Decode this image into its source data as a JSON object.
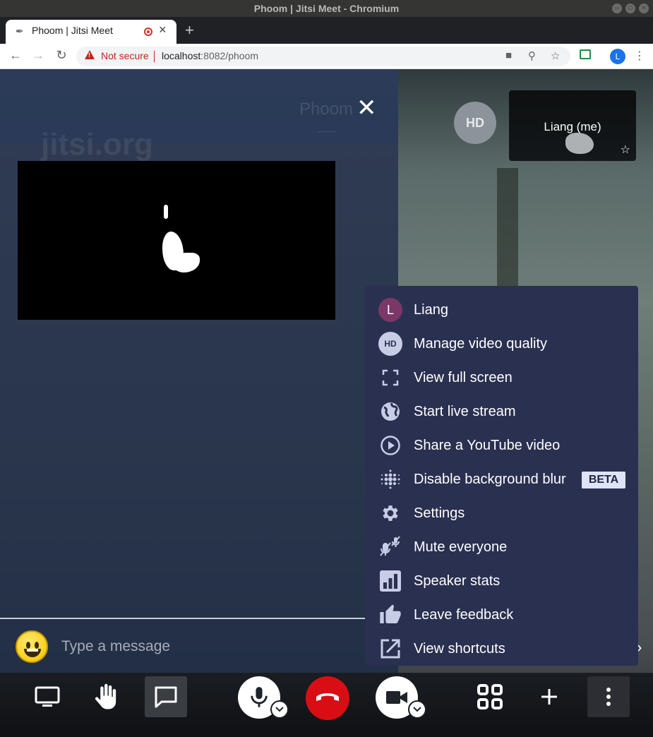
{
  "window": {
    "title": "Phoom | Jitsi Meet - Chromium"
  },
  "browser": {
    "tab_title": "Phoom | Jitsi Meet",
    "security_label": "Not secure",
    "url_host": "localhost",
    "url_path": ":8082/phoom",
    "profile_initial": "L"
  },
  "meeting": {
    "watermark": "jitsi.org",
    "subject": "Phoom",
    "subject_sub": "——",
    "participant_avatar": "HD",
    "self_name": "Liang (me)"
  },
  "chat": {
    "input_placeholder": "Type a message"
  },
  "menu": {
    "items": [
      {
        "label": "Liang",
        "icon": "avatar-icon",
        "initial": "L"
      },
      {
        "label": "Manage video quality",
        "icon": "hd-icon",
        "initial": "HD"
      },
      {
        "label": "View full screen",
        "icon": "fullscreen-icon"
      },
      {
        "label": "Start live stream",
        "icon": "globe-icon"
      },
      {
        "label": "Share a YouTube video",
        "icon": "play-circle-icon"
      },
      {
        "label": "Disable background blur",
        "icon": "blur-icon",
        "badge": "BETA"
      },
      {
        "label": "Settings",
        "icon": "gear-icon"
      },
      {
        "label": "Mute everyone",
        "icon": "mute-everyone-icon"
      },
      {
        "label": "Speaker stats",
        "icon": "stats-icon"
      },
      {
        "label": "Leave feedback",
        "icon": "thumbs-up-icon"
      },
      {
        "label": "View shortcuts",
        "icon": "open-external-icon"
      }
    ]
  },
  "colors": {
    "menu_bg": "#2a3050",
    "hangup": "#d90e15",
    "avatar_l": "#7c3769"
  }
}
